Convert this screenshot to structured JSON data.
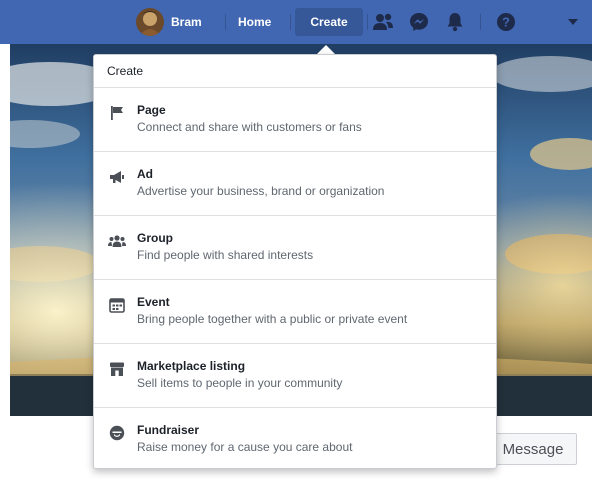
{
  "nav": {
    "profile_name": "Bram",
    "home_label": "Home",
    "create_label": "Create",
    "icons": [
      "friends-icon",
      "messenger-icon",
      "notifications-icon",
      "help-icon",
      "account-menu-chevron-icon"
    ]
  },
  "dropdown": {
    "header": "Create",
    "items": [
      {
        "icon": "flag-icon",
        "title": "Page",
        "description": "Connect and share with customers or fans"
      },
      {
        "icon": "megaphone-icon",
        "title": "Ad",
        "description": "Advertise your business, brand or organization"
      },
      {
        "icon": "group-icon",
        "title": "Group",
        "description": "Find people with shared interests"
      },
      {
        "icon": "calendar-icon",
        "title": "Event",
        "description": "Bring people together with a public or private event"
      },
      {
        "icon": "storefront-icon",
        "title": "Marketplace listing",
        "description": "Sell items to people in your community"
      },
      {
        "icon": "fundraiser-icon",
        "title": "Fundraiser",
        "description": "Raise money for a cause you care about"
      }
    ]
  },
  "message_button_label": "Message",
  "colors": {
    "topbar": "#4267b2",
    "active_tab": "#365899",
    "text_primary": "#1d2129",
    "text_secondary": "#606770"
  }
}
